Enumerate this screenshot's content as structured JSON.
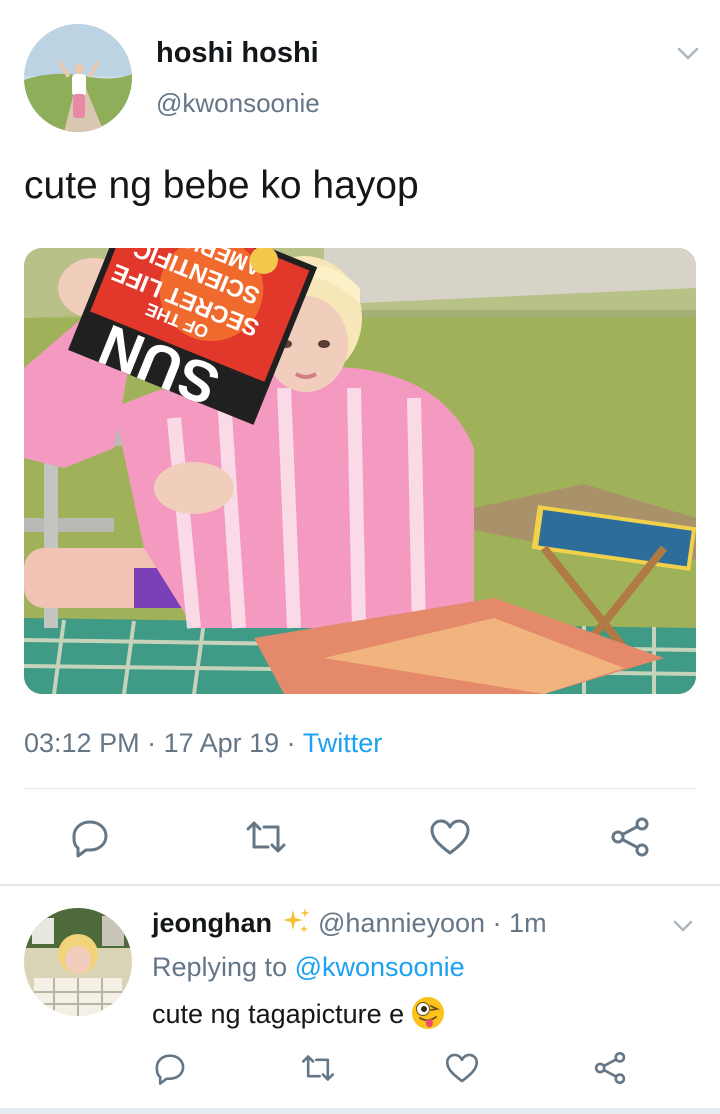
{
  "tweet": {
    "display_name": "hoshi hoshi",
    "handle": "@kwonsoonie",
    "text": "cute ng bebe ko hayop",
    "time": "03:12 PM",
    "dot1": " · ",
    "date": "17 Apr 19",
    "dot2": " · ",
    "source": "Twitter",
    "photo_magazine_lines": [
      "SUN",
      "SECRET LIFE",
      "OF THE",
      "SCIENTIFIC",
      "AMERICAN"
    ],
    "actions": [
      "reply-icon",
      "retweet-icon",
      "like-icon",
      "share-icon"
    ]
  },
  "reply": {
    "display_name": "jeonghan",
    "emoji_name": "sparkles-icon",
    "handle": "@hannieyoon",
    "dot": " · ",
    "age": "1m",
    "replying_prefix": "Replying to ",
    "replying_to": "@kwonsoonie",
    "text": "cute ng tagapicture e",
    "text_emoji": "winking-tongue-emoji",
    "actions": [
      "reply-icon",
      "retweet-icon",
      "like-icon",
      "share-icon"
    ]
  },
  "colors": {
    "text": "#14171a",
    "secondary": "#657786",
    "link": "#1da1f2",
    "divider": "#e1e8ed",
    "icon": "#657786"
  }
}
